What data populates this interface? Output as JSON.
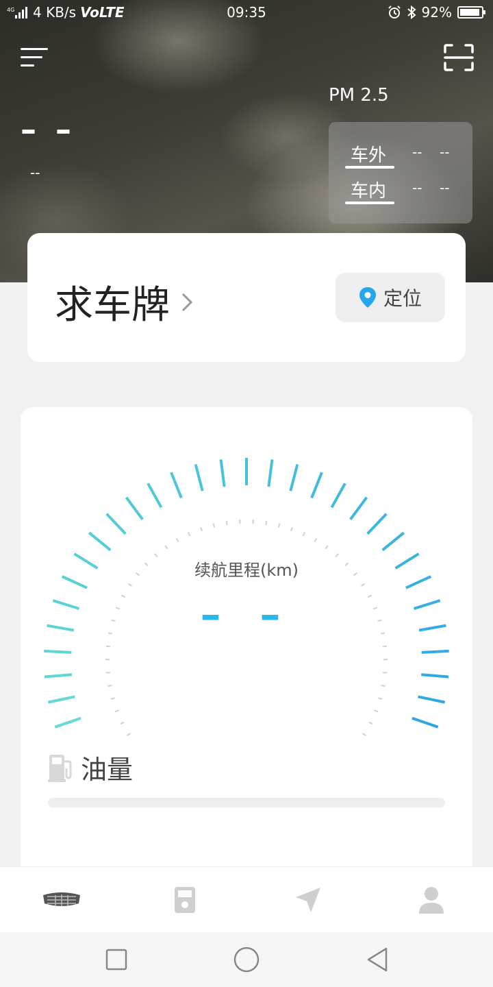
{
  "status_bar": {
    "network": "4G",
    "speed": "4 KB/s",
    "volte": "VoLTE",
    "time": "09:35",
    "battery": "92%",
    "battery_level": 0.92
  },
  "weather": {
    "temperature": "– –",
    "description": "--"
  },
  "pm25": {
    "title": "PM 2.5",
    "outside": {
      "label": "车外",
      "value1": "--",
      "value2": "--"
    },
    "inside": {
      "label": "车内",
      "value1": "--",
      "value2": "--"
    }
  },
  "car": {
    "plate": "求车牌",
    "locate_label": "定位"
  },
  "gauge": {
    "label": "续航里程(km)",
    "value": "– –"
  },
  "fuel": {
    "label": "油量",
    "level": 0
  },
  "colors": {
    "accent": "#27b8f0",
    "gauge_start": "#1e9be8",
    "gauge_end": "#6fe8d0"
  },
  "tabs": [
    {
      "icon": "geely-logo-icon"
    },
    {
      "icon": "fuel-station-icon"
    },
    {
      "icon": "navigation-arrow-icon"
    },
    {
      "icon": "person-icon"
    }
  ],
  "system_nav": [
    "recent-apps-icon",
    "home-icon",
    "back-icon"
  ]
}
